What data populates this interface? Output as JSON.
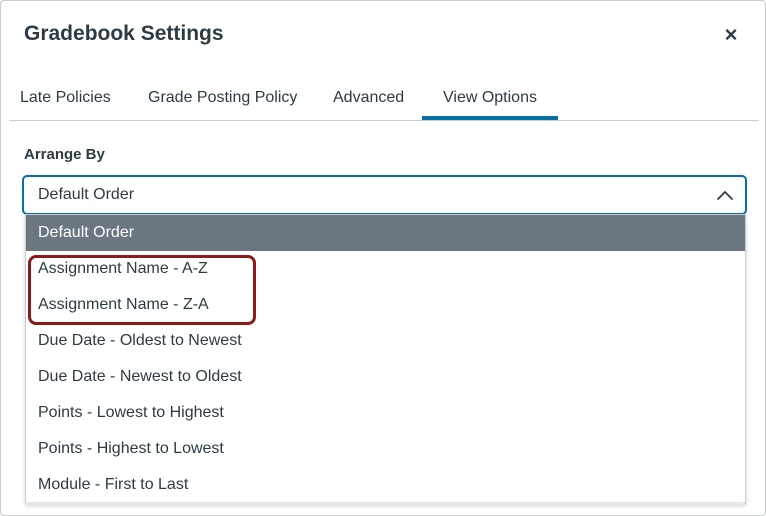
{
  "dialog": {
    "title": "Gradebook Settings",
    "close_icon": "close-icon",
    "close_glyph": "×"
  },
  "tabs": [
    {
      "label": "Late Policies",
      "active": false
    },
    {
      "label": "Grade Posting Policy",
      "active": false
    },
    {
      "label": "Advanced",
      "active": false
    },
    {
      "label": "View Options",
      "active": true
    }
  ],
  "arrange_by": {
    "label": "Arrange By",
    "selected_value": "Default Order",
    "expanded": true,
    "chevron_icon": "chevron-up-icon",
    "options": [
      {
        "label": "Default Order",
        "selected": true
      },
      {
        "label": "Assignment Name - A-Z",
        "selected": false
      },
      {
        "label": "Assignment Name - Z-A",
        "selected": false
      },
      {
        "label": "Due Date - Oldest to Newest",
        "selected": false
      },
      {
        "label": "Due Date - Newest to Oldest",
        "selected": false
      },
      {
        "label": "Points - Lowest to Highest",
        "selected": false
      },
      {
        "label": "Points - Highest to Lowest",
        "selected": false
      },
      {
        "label": "Module - First to Last",
        "selected": false
      }
    ]
  },
  "colors": {
    "accent": "#0770a3",
    "selected_option_bg": "#6b7780",
    "annotation_outline": "#8b1a1a",
    "text": "#2d3b45"
  }
}
